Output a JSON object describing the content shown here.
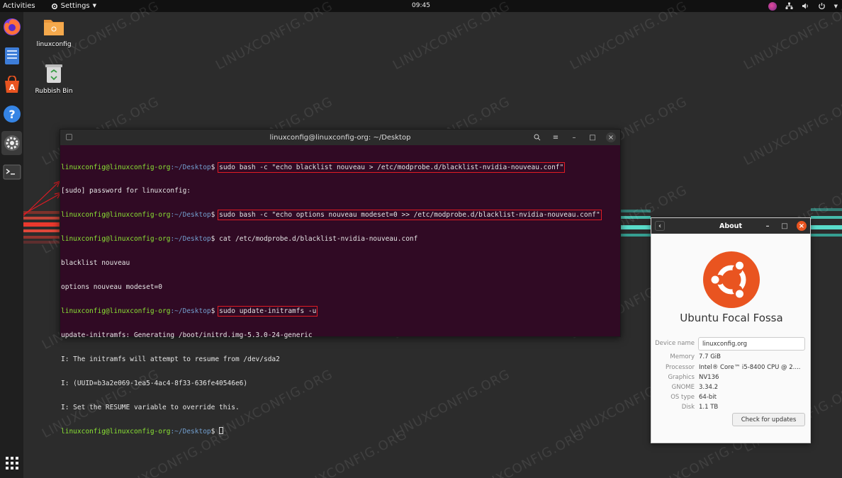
{
  "topbar": {
    "activities": "Activities",
    "settings": "Settings",
    "clock": "09:45"
  },
  "desktop": {
    "icons": [
      {
        "label": "linuxconfig"
      },
      {
        "label": "Rubbish Bin"
      }
    ],
    "watermark": "LINUXCONFIG.ORG"
  },
  "terminal": {
    "title": "linuxconfig@linuxconfig-org: ~/Desktop",
    "prompt_user": "linuxconfig@linuxconfig-org",
    "prompt_path": ":~/Desktop",
    "prompt_sign": "$ ",
    "lines": {
      "cmd1": "sudo bash -c \"echo blacklist nouveau > /etc/modprobe.d/blacklist-nvidia-nouveau.conf\"",
      "out1": "[sudo] password for linuxconfig:",
      "cmd2": "sudo bash -c \"echo options nouveau modeset=0 >> /etc/modprobe.d/blacklist-nvidia-nouveau.conf\"",
      "cmd3": "cat /etc/modprobe.d/blacklist-nvidia-nouveau.conf",
      "out2": "blacklist nouveau",
      "out3": "options nouveau modeset=0",
      "cmd4": "sudo update-initramfs -u",
      "out4": "update-initramfs: Generating /boot/initrd.img-5.3.0-24-generic",
      "out5": "I: The initramfs will attempt to resume from /dev/sda2",
      "out6": "I: (UUID=b3a2e069-1ea5-4ac4-8f33-636fe40546e6)",
      "out7": "I: Set the RESUME variable to override this."
    }
  },
  "about": {
    "title": "About",
    "os_name": "Ubuntu Focal Fossa",
    "device_name_label": "Device name",
    "device_name_value": "linuxconfig.org",
    "rows": [
      {
        "label": "Memory",
        "value": "7.7 GiB"
      },
      {
        "label": "Processor",
        "value": "Intel® Core™ i5-8400 CPU @ 2...."
      },
      {
        "label": "Graphics",
        "value": "NV136"
      },
      {
        "label": "GNOME",
        "value": "3.34.2"
      },
      {
        "label": "OS type",
        "value": "64-bit"
      },
      {
        "label": "Disk",
        "value": "1.1 TB"
      }
    ],
    "check_updates": "Check for updates"
  },
  "colors": {
    "terminal_bg": "#300a24",
    "prompt_user": "#8ae234",
    "prompt_path": "#729fcf",
    "highlight_box": "#e01b24",
    "ubuntu_orange": "#e95420"
  }
}
